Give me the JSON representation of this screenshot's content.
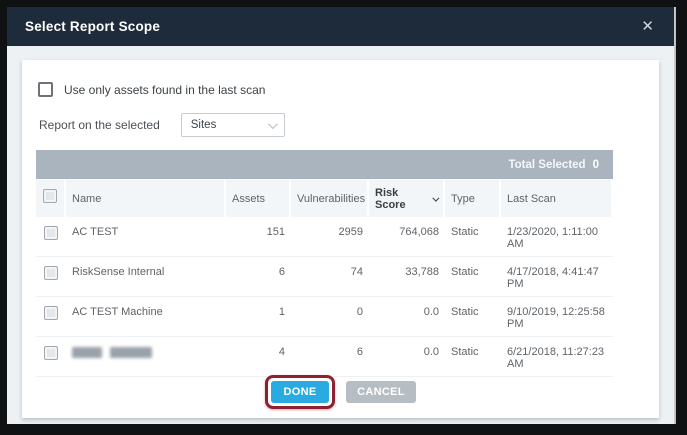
{
  "modal": {
    "title": "Select Report Scope",
    "close_icon": "✕"
  },
  "controls": {
    "last_scan_checkbox_label": "Use only assets found in the last scan",
    "last_scan_checkbox_checked": false,
    "report_on_label": "Report on the selected",
    "scope_dropdown_value": "Sites"
  },
  "table": {
    "total_selected_label": "Total Selected",
    "total_selected_count": "0",
    "columns": [
      {
        "key": "name",
        "label": "Name",
        "align": "left",
        "sorted": false
      },
      {
        "key": "assets",
        "label": "Assets",
        "align": "left",
        "sorted": false
      },
      {
        "key": "vulnerabilities",
        "label": "Vulnerabilities",
        "align": "left",
        "sorted": false
      },
      {
        "key": "risk_score",
        "label": "Risk Score",
        "align": "left",
        "sorted": true,
        "sort_direction": "desc"
      },
      {
        "key": "type",
        "label": "Type",
        "align": "left",
        "sorted": false
      },
      {
        "key": "last_scan",
        "label": "Last Scan",
        "align": "left",
        "sorted": false
      }
    ],
    "rows": [
      {
        "name": "AC TEST",
        "name_redacted": false,
        "assets": "151",
        "vulnerabilities": "2959",
        "risk_score": "764,068",
        "type": "Static",
        "last_scan": "1/23/2020, 1:11:00 AM",
        "checked": false
      },
      {
        "name": "RiskSense Internal",
        "name_redacted": false,
        "assets": "6",
        "vulnerabilities": "74",
        "risk_score": "33,788",
        "type": "Static",
        "last_scan": "4/17/2018, 4:41:47 PM",
        "checked": false
      },
      {
        "name": "AC TEST Machine",
        "name_redacted": false,
        "assets": "1",
        "vulnerabilities": "0",
        "risk_score": "0.0",
        "type": "Static",
        "last_scan": "9/10/2019, 12:25:58 PM",
        "checked": false
      },
      {
        "name": "",
        "name_redacted": true,
        "assets": "4",
        "vulnerabilities": "6",
        "risk_score": "0.0",
        "type": "Static",
        "last_scan": "6/21/2018, 11:27:23 AM",
        "checked": false
      }
    ]
  },
  "footer": {
    "done_label": "DONE",
    "cancel_label": "CANCEL",
    "done_annotated": true
  },
  "colors": {
    "header_bg": "#1e2b3a",
    "body_bg": "#edf1f4",
    "total_bar_bg": "#a9b4be",
    "done_blue": "#29abe2",
    "cancel_gray": "#b6bdc3",
    "annotation_red": "#8e2130"
  }
}
